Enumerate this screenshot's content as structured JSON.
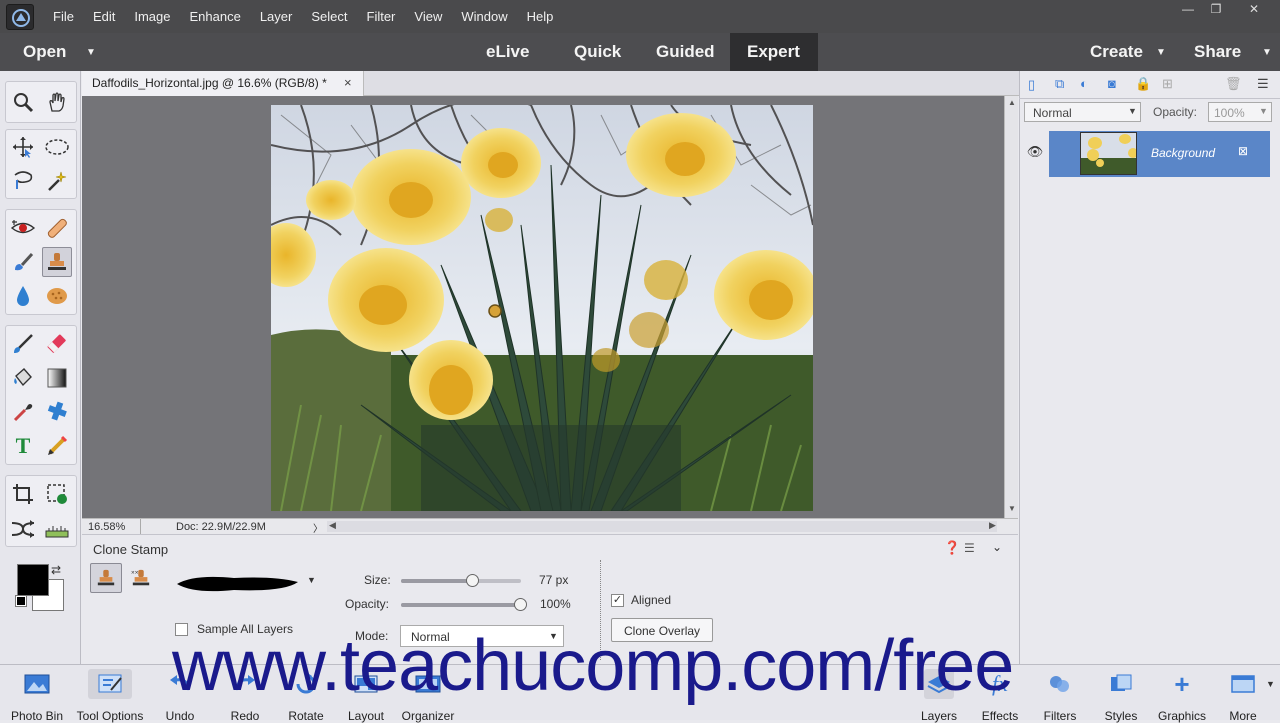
{
  "menubar": {
    "items": [
      "File",
      "Edit",
      "Image",
      "Enhance",
      "Layer",
      "Select",
      "Filter",
      "View",
      "Window",
      "Help"
    ],
    "minimize": "—",
    "restore": "❐",
    "close": "✕"
  },
  "modebar": {
    "open_label": "Open",
    "modes": [
      "eLive",
      "Quick",
      "Guided",
      "Expert"
    ],
    "active_mode": "Expert",
    "create_label": "Create",
    "share_label": "Share"
  },
  "document": {
    "tab_title": "Daffodils_Horizontal.jpg @ 16.6% (RGB/8) *",
    "close": "×",
    "zoom": "16.58%",
    "doc_size": "Doc: 22.9M/22.9M"
  },
  "tool_options": {
    "title": "Clone Stamp",
    "size_label": "Size:",
    "size_value": "77 px",
    "size_level": 0.6,
    "opacity_label": "Opacity:",
    "opacity_value": "100%",
    "opacity_level": 1.0,
    "mode_label": "Mode:",
    "mode_value": "Normal",
    "sample_all_layers": "Sample All Layers",
    "sample_all_layers_checked": false,
    "aligned": "Aligned",
    "aligned_checked": true,
    "clone_overlay": "Clone Overlay"
  },
  "layers_panel": {
    "blend_mode": "Normal",
    "opacity_label": "Opacity:",
    "opacity_value": "100%",
    "layer_name": "Background"
  },
  "bottombar": {
    "left": [
      "Photo Bin",
      "Tool Options",
      "Undo",
      "Redo",
      "Rotate",
      "Layout",
      "Organizer"
    ],
    "right": [
      "Layers",
      "Effects",
      "Filters",
      "Styles",
      "Graphics",
      "More"
    ]
  },
  "watermark": "www.teachucomp.com/free",
  "colors": {
    "accent_selected_layer": "#5a86c8",
    "canvas_bg": "#747478",
    "watermark": "#1a1a8c"
  }
}
